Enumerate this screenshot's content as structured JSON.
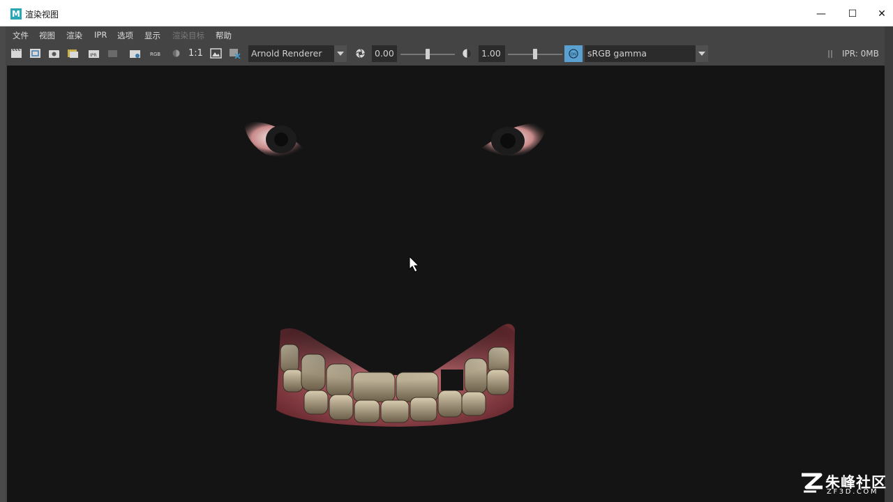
{
  "window": {
    "title": "渲染视图",
    "app_icon_letter": "M",
    "minimize": "—",
    "maximize": "☐",
    "close": "✕"
  },
  "menu": {
    "items": [
      "文件",
      "视图",
      "渲染",
      "IPR",
      "选项",
      "显示",
      "渲染目标",
      "帮助"
    ]
  },
  "toolbar": {
    "one_to_one": "1:1",
    "renderer": "Arnold Renderer",
    "exposure": "0.00",
    "gamma": "1.00",
    "view_transform": "sRGB gamma",
    "rgb_label": "RGB",
    "ipr_memory": "IPR: 0MB"
  },
  "watermark": {
    "brand": "朱峰社区",
    "domain": "ZF3D.COM"
  },
  "colors": {
    "viewport_bg": "#141414",
    "panel": "#444444",
    "accent": "#5aa0d0"
  }
}
